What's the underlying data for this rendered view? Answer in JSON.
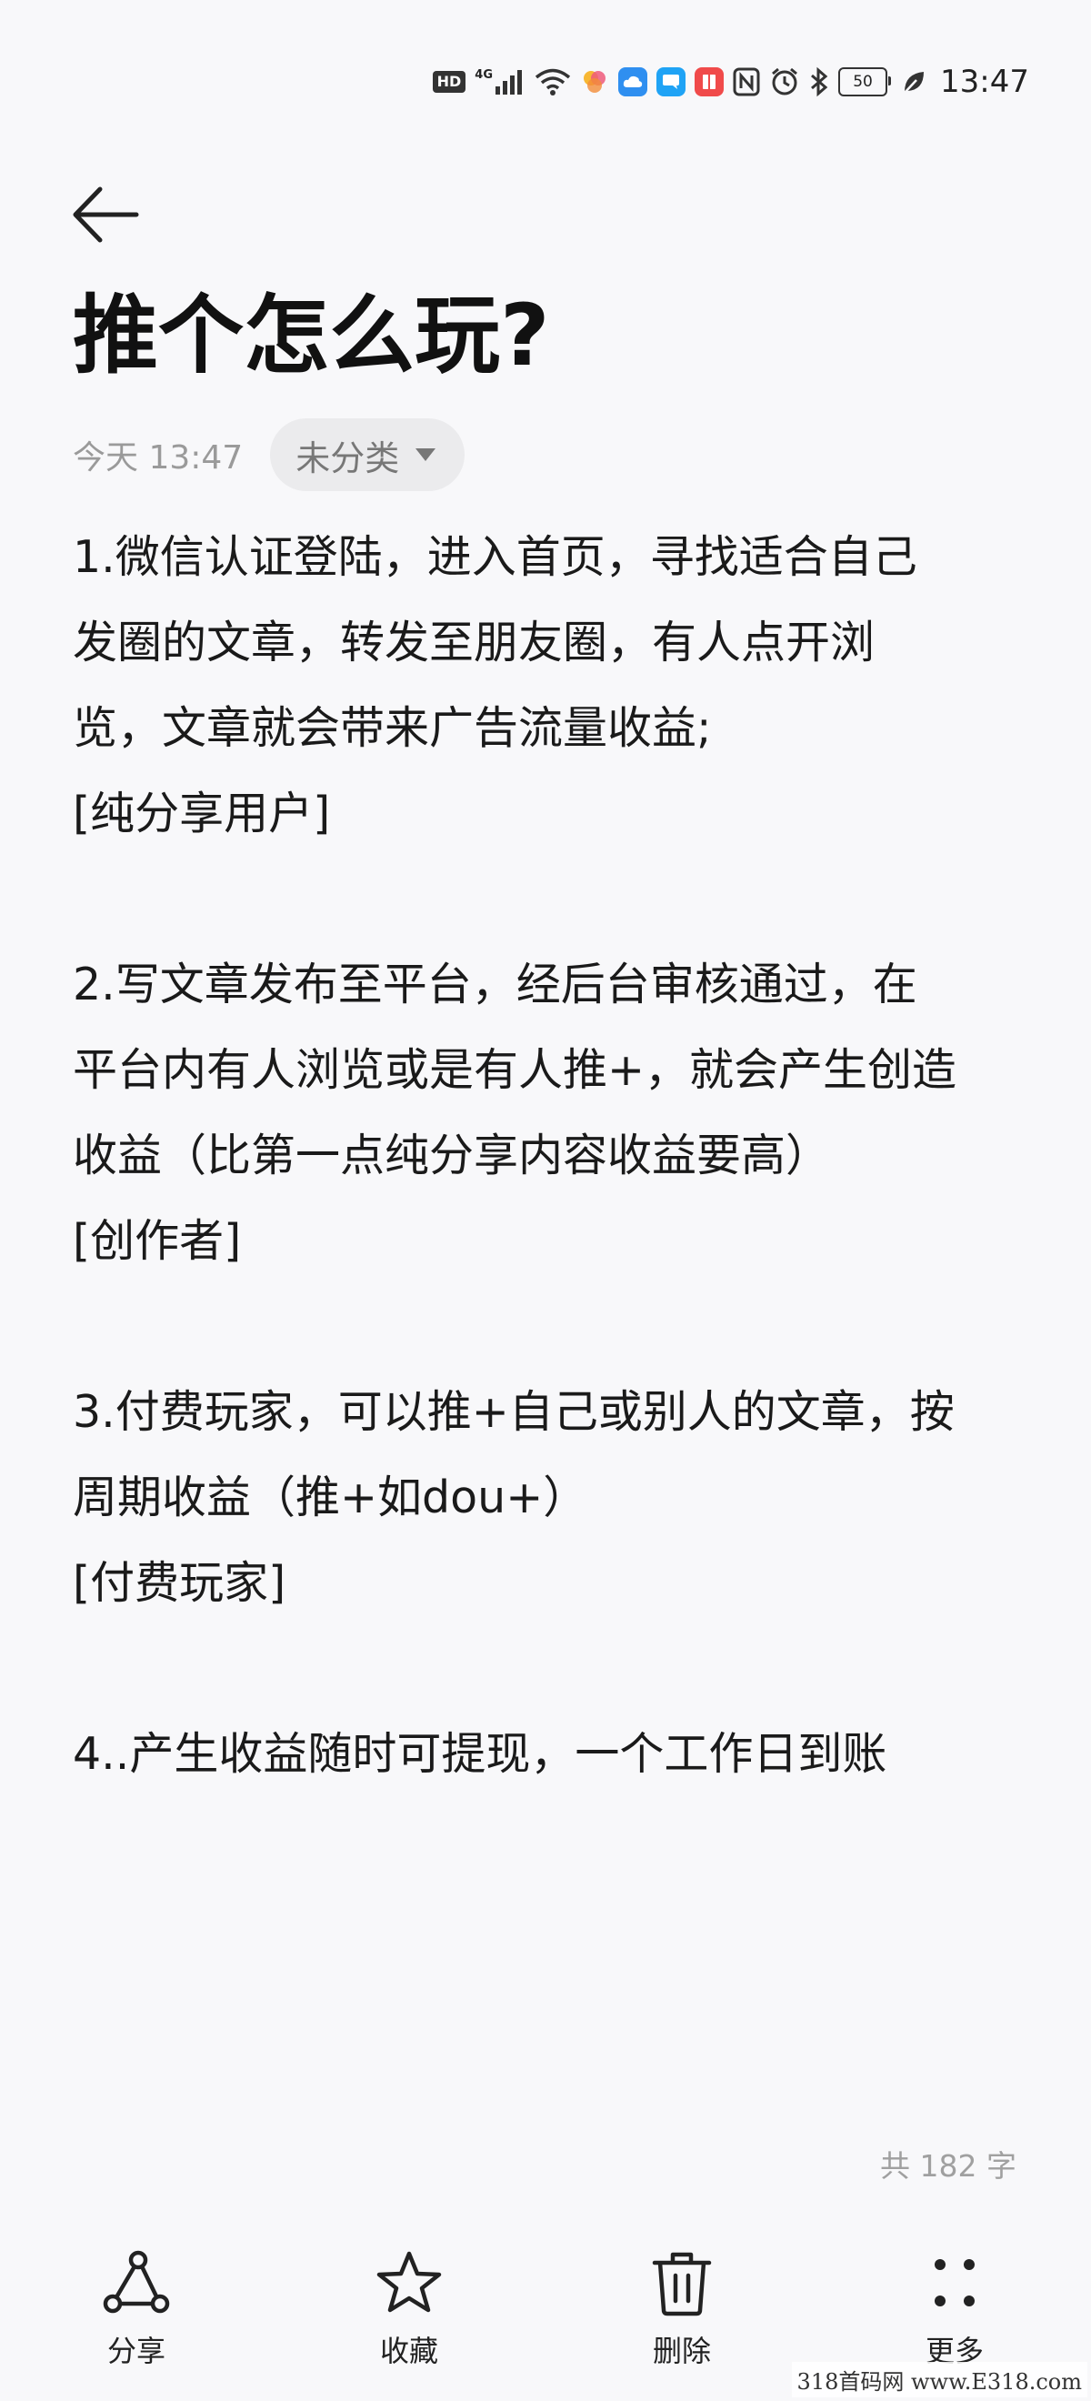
{
  "status_bar": {
    "hd": "HD",
    "network": "4G",
    "battery": "50",
    "time": "13:47",
    "icons": [
      "signal-icon",
      "wifi-icon",
      "app-notification-icons",
      "nfc-icon",
      "alarm-icon",
      "bluetooth-icon",
      "battery-icon",
      "eco-leaf-icon"
    ]
  },
  "header": {
    "back_icon": "arrow-left-icon",
    "title": "推个怎么玩?"
  },
  "meta": {
    "date": "今天 13:47",
    "category": "未分类"
  },
  "note": {
    "lines": [
      "1.微信认证登陆，进入首页，寻找适合自己",
      "发圈的文章，转发至朋友圈，有人点开浏",
      "览，文章就会带来广告流量收益;",
      "[纯分享用户]",
      "",
      "2.写文章发布至平台，经后台审核通过，在",
      "平台内有人浏览或是有人推+，就会产生创造",
      "收益（比第一点纯分享内容收益要高）",
      "[创作者]",
      "",
      "3.付费玩家，可以推+自己或别人的文章，按",
      "周期收益（推+如dou+）",
      "[付费玩家]",
      "",
      "4..产生收益随时可提现，一个工作日到账"
    ]
  },
  "word_count": "共 182 字",
  "bottom_bar": {
    "actions": [
      {
        "label": "分享",
        "icon": "share-icon"
      },
      {
        "label": "收藏",
        "icon": "star-icon"
      },
      {
        "label": "删除",
        "icon": "trash-icon"
      },
      {
        "label": "更多",
        "icon": "more-dots-icon"
      }
    ]
  },
  "watermark": "318首码网 www.E318.com",
  "colors": {
    "background": "#f8f8fa",
    "text": "#1a1a1a",
    "muted": "#9a9a9a",
    "pill": "#ebebed"
  }
}
